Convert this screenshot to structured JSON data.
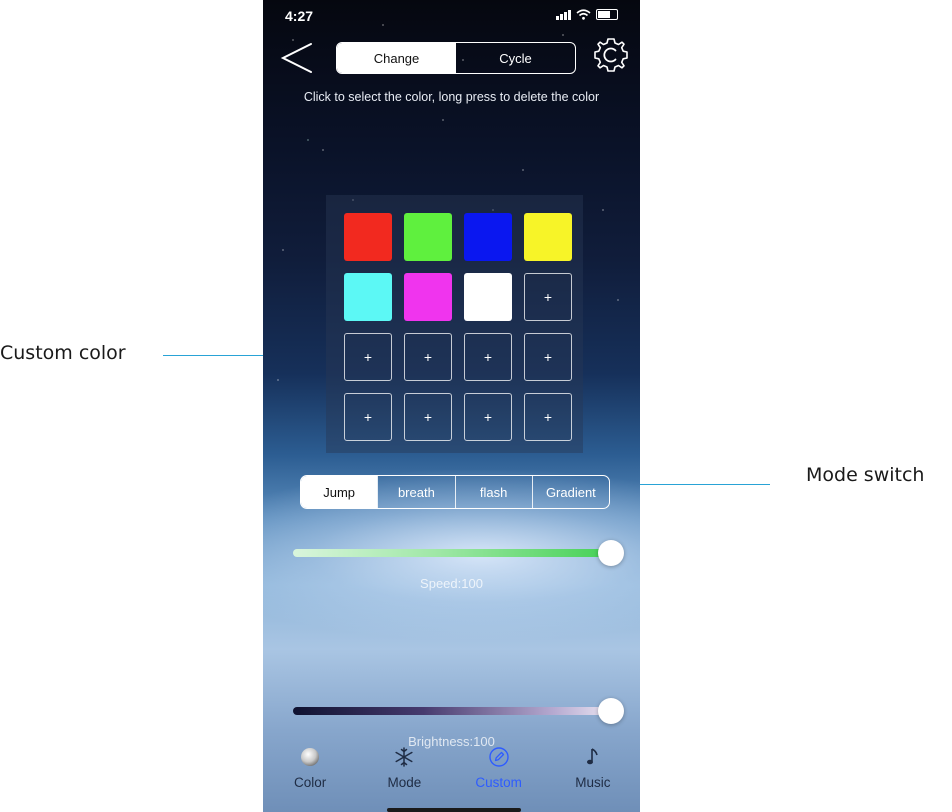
{
  "annotations": {
    "custom_color": "Custom color",
    "mode_switch": "Mode switch"
  },
  "status_bar": {
    "time": "4:27"
  },
  "header": {
    "tabs": [
      {
        "label": "Change",
        "selected": true
      },
      {
        "label": "Cycle",
        "selected": false
      }
    ],
    "back_icon": "chevron-left-icon",
    "settings_icon": "gear-icon"
  },
  "hint": "Click to select the color, long press to delete the color",
  "color_grid": {
    "filled": [
      "#f2291f",
      "#5ff03e",
      "#0a17f0",
      "#f7f428",
      "#5cf8f5",
      "#f034ee",
      "#ffffff"
    ],
    "add_label": "+",
    "add_slots": 9
  },
  "modes": [
    {
      "label": "Jump",
      "selected": true
    },
    {
      "label": "breath",
      "selected": false
    },
    {
      "label": "flash",
      "selected": false
    },
    {
      "label": "Gradient",
      "selected": false
    }
  ],
  "speed": {
    "label": "Speed:100",
    "value": 100,
    "max": 100
  },
  "brightness": {
    "label": "Brightness:100",
    "value": 100,
    "max": 100
  },
  "tab_bar": {
    "items": [
      {
        "label": "Color",
        "icon": "color-disc-icon",
        "active": false
      },
      {
        "label": "Mode",
        "icon": "snowflake-icon",
        "active": false
      },
      {
        "label": "Custom",
        "icon": "edit-icon",
        "active": true
      },
      {
        "label": "Music",
        "icon": "music-note-icon",
        "active": false
      }
    ]
  },
  "colors": {
    "accent": "#2e5cff",
    "annotation_line": "#29a3d6"
  }
}
